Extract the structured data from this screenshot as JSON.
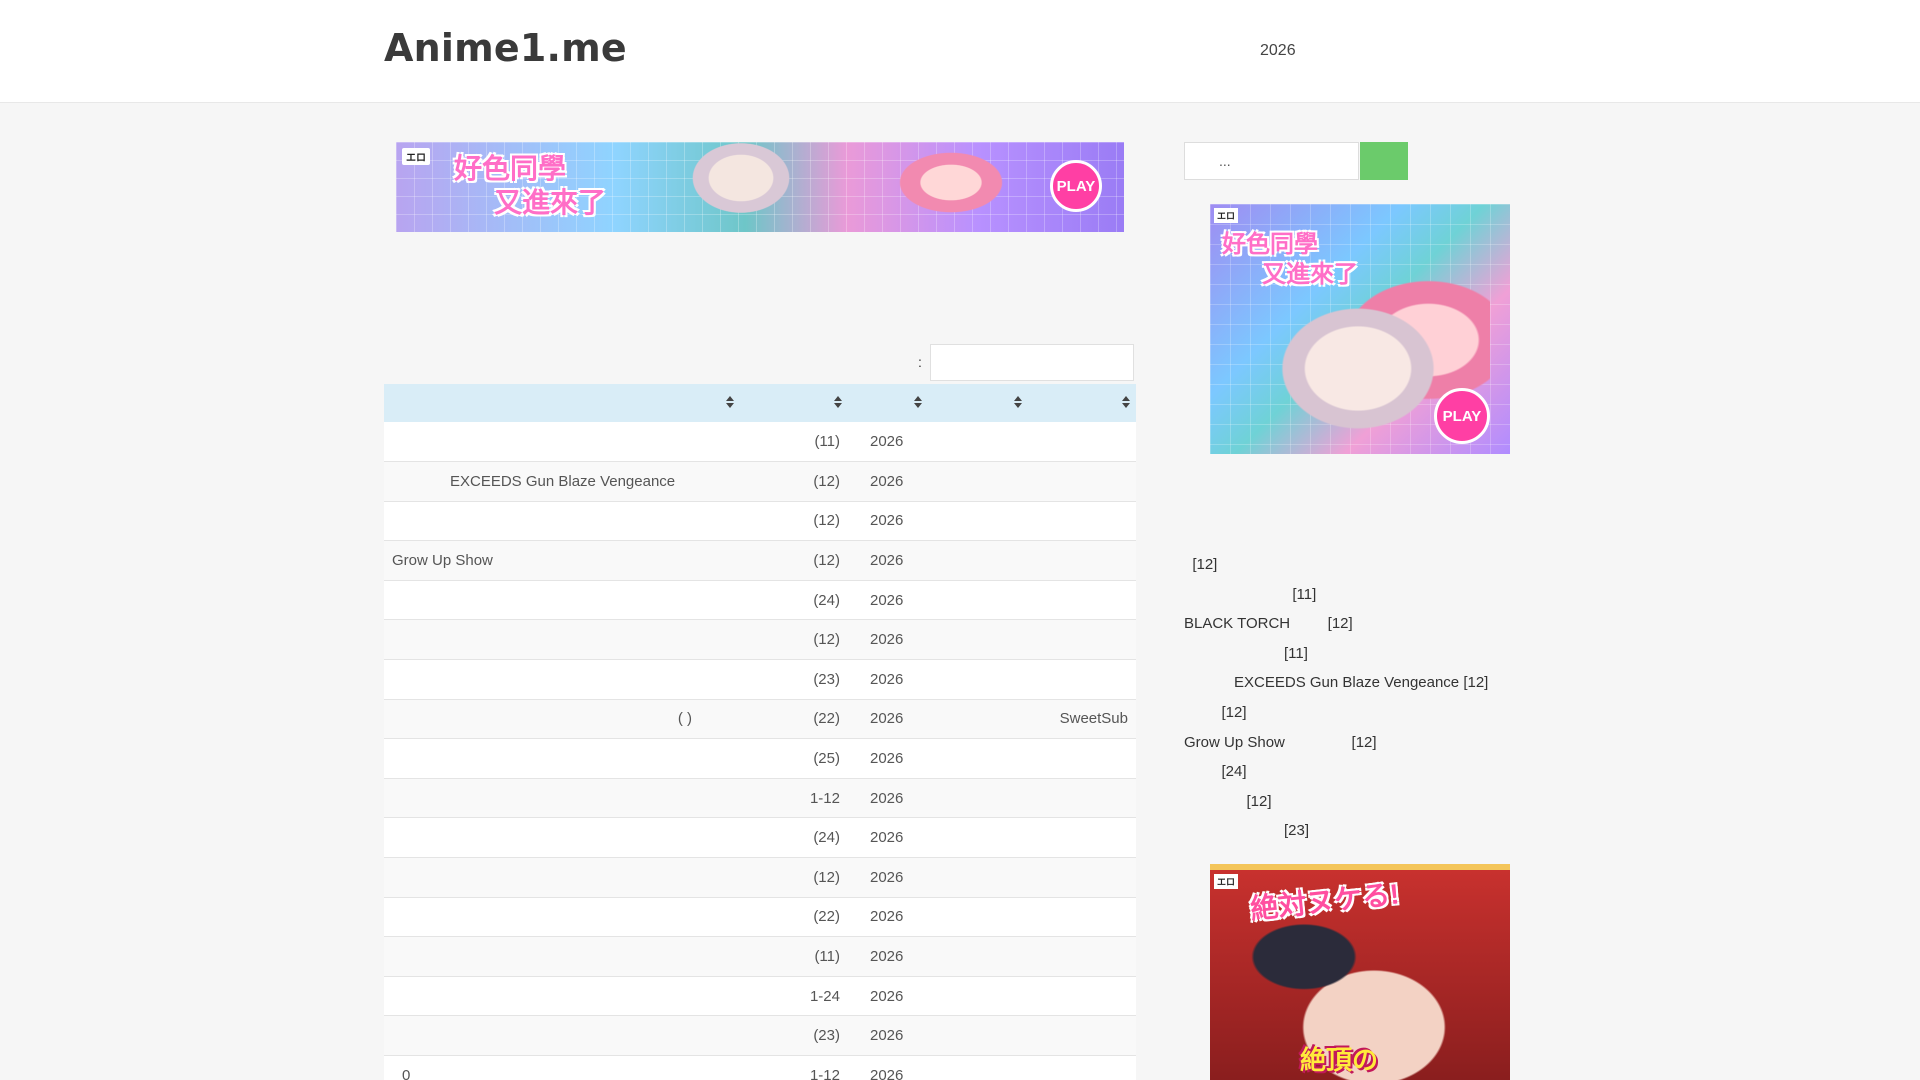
{
  "header": {
    "site_title": "Anime1.me",
    "nav_year": "2026"
  },
  "banner": {
    "tag": "エロ",
    "title_line1": "好色同學",
    "title_line2": "又進來了",
    "play_label": "PLAY"
  },
  "table_filter": {
    "label": ":",
    "value": ""
  },
  "table": {
    "rows": [
      {
        "name": "",
        "episodes": "(11)",
        "year": "2026",
        "season": "",
        "subtitle": ""
      },
      {
        "name": "EXCEEDS Gun Blaze Vengeance",
        "episodes": "(12)",
        "year": "2026",
        "season": "",
        "subtitle": "",
        "indent": true
      },
      {
        "name": "",
        "episodes": "(12)",
        "year": "2026",
        "season": "",
        "subtitle": ""
      },
      {
        "name": "Grow Up Show",
        "episodes": "(12)",
        "year": "2026",
        "season": "",
        "subtitle": ""
      },
      {
        "name": "",
        "episodes": "(24)",
        "year": "2026",
        "season": "",
        "subtitle": ""
      },
      {
        "name": "",
        "episodes": "(12)",
        "year": "2026",
        "season": "",
        "subtitle": ""
      },
      {
        "name": "",
        "episodes": "(23)",
        "year": "2026",
        "season": "",
        "subtitle": ""
      },
      {
        "name": "(      )",
        "episodes": "(22)",
        "year": "2026",
        "season": "",
        "subtitle": "SweetSub",
        "right": true
      },
      {
        "name": "",
        "episodes": "(25)",
        "year": "2026",
        "season": "",
        "subtitle": ""
      },
      {
        "name": "",
        "episodes": "1-12",
        "year": "2026",
        "season": "",
        "subtitle": ""
      },
      {
        "name": "",
        "episodes": "(24)",
        "year": "2026",
        "season": "",
        "subtitle": ""
      },
      {
        "name": "",
        "episodes": "(12)",
        "year": "2026",
        "season": "",
        "subtitle": ""
      },
      {
        "name": "",
        "episodes": "(22)",
        "year": "2026",
        "season": "",
        "subtitle": ""
      },
      {
        "name": "",
        "episodes": "(11)",
        "year": "2026",
        "season": "",
        "subtitle": ""
      },
      {
        "name": "",
        "episodes": "1-24",
        "year": "2026",
        "season": "",
        "subtitle": ""
      },
      {
        "name": "",
        "episodes": "(23)",
        "year": "2026",
        "season": "",
        "subtitle": ""
      },
      {
        "name": "0",
        "episodes": "1-12",
        "year": "2026",
        "season": "",
        "subtitle": ""
      }
    ]
  },
  "sidebar": {
    "search_placeholder": "...",
    "ad1": {
      "tag": "エロ",
      "title_line1": "好色同學",
      "title_line2": "又進來了",
      "play_label": "PLAY"
    },
    "recent": [
      "  [12]",
      "                          [11]",
      "BLACK TORCH         [12]",
      "                        [11]",
      "            EXCEEDS Gun Blaze Vengeance [12]",
      "         [12]",
      "Grow Up Show                [12]",
      "         [24]",
      "               [12]",
      "                        [23]"
    ],
    "ad2": {
      "tag": "エロ",
      "title_line1": "絶対ヌケる!",
      "title_line2": "絶頂の"
    }
  },
  "colors": {
    "header_bg": "#ffffff",
    "page_bg": "#f6f6f6",
    "table_head_bg": "#d9edf7",
    "search_button": "#6bcb6b",
    "play_button": "#ff3fa4"
  }
}
